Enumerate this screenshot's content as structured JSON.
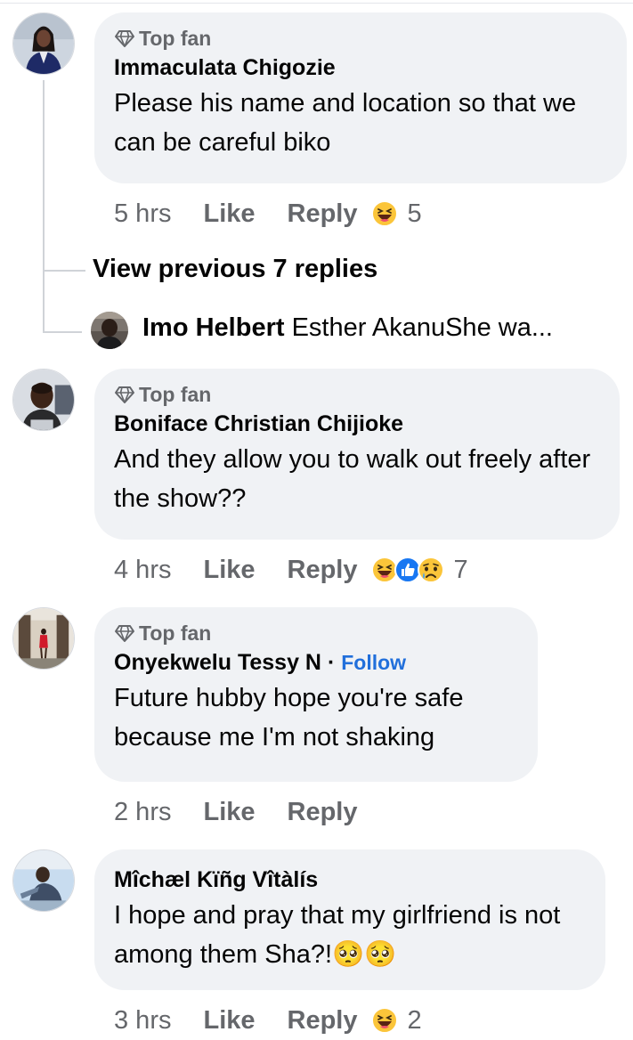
{
  "comments": [
    {
      "badge": "Top fan",
      "author": "Immaculata Chigozie",
      "text": "Please his name and location so that we can be careful biko",
      "time": "5 hrs",
      "like": "Like",
      "reply": "Reply",
      "reactions": [
        "haha"
      ],
      "reaction_count": "5"
    },
    {
      "badge": "Top fan",
      "author": "Boniface Christian Chijioke",
      "text": "And they allow you to walk out freely after the show??",
      "time": "4 hrs",
      "like": "Like",
      "reply": "Reply",
      "reactions": [
        "haha",
        "like",
        "sad"
      ],
      "reaction_count": "7"
    },
    {
      "badge": "Top fan",
      "author": "Onyekwelu Tessy N",
      "follow": "Follow",
      "text": "Future hubby hope you're safe because me I'm not shaking",
      "time": "2 hrs",
      "like": "Like",
      "reply": "Reply"
    },
    {
      "author": "Mîchæl Kïñg Vîtàlís",
      "text": "I hope and pray that my girlfriend is not among them Sha?!🥺🥺",
      "time": "3 hrs",
      "like": "Like",
      "reply": "Reply",
      "reactions": [
        "haha"
      ],
      "reaction_count": "2"
    }
  ],
  "thread": {
    "view_previous": "View previous 7 replies",
    "preview_author": "Imo Helbert",
    "preview_text": "Esther AkanuShe wa..."
  },
  "colors": {
    "bubble": "#f0f2f5",
    "secondary_text": "#65676b",
    "link_blue": "#216fdb"
  },
  "icons": [
    "top-fan-gem-icon",
    "haha-reaction-icon",
    "like-reaction-icon",
    "sad-reaction-icon"
  ]
}
